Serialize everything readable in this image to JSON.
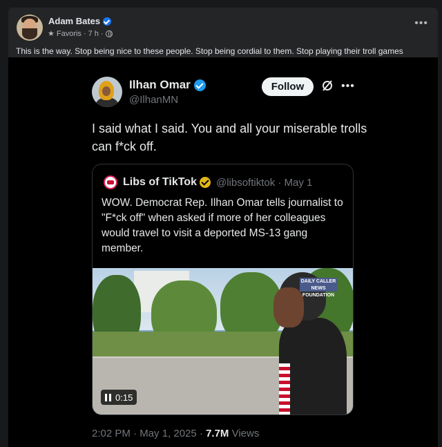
{
  "facebook_post": {
    "author": "Adam Bates",
    "audience": "Favoris",
    "time": "7 h",
    "text": "This is the way. Stop being nice to these people. Stop being cordial to them. Stop playing their troll games",
    "more_icon": "more-horizontal-icon"
  },
  "tweet": {
    "name": "Ilhan Omar",
    "handle": "@IlhanMN",
    "follow_label": "Follow",
    "text": "I said what I said. You and all your miserable trolls can f*ck off.",
    "timestamp": "2:02 PM · May 1, 2025 · ",
    "views_count": "7.7M",
    "views_label": " Views",
    "quote": {
      "name": "Libs of TikTok",
      "handle": "@libsoftiktok · May 1",
      "text": "WOW. Democrat Rep. Ilhan Omar tells journalist to \"F*ck off\" when asked if more of her colleagues would travel to visit a deported MS-13 gang member.",
      "video_time": "0:15",
      "watermark": "DAILY CALLER NEWS FOUNDATION"
    }
  },
  "colors": {
    "fb_bg": "#242526",
    "x_verified": "#1d9bf0",
    "gold_verified": "#e2b719"
  }
}
